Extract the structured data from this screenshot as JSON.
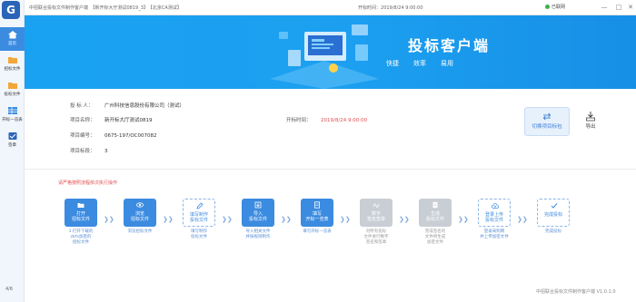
{
  "window": {
    "title": "中招联合投标文件制作客户端　【新开标大厅测试0819_3】　【北京CA测试】",
    "time_label": "开标时间：",
    "time_value": "2019/8/24 9:00:00",
    "network_status": "已联网",
    "network_color": "#3db14a"
  },
  "sidebar": {
    "logo": "G",
    "items": [
      {
        "label": "首页",
        "icon": "home-icon",
        "active": true
      },
      {
        "label": "招标文件",
        "icon": "folder-icon",
        "active": false
      },
      {
        "label": "投标文件",
        "icon": "folder-icon",
        "active": false
      },
      {
        "label": "开标一览表",
        "icon": "table-icon",
        "active": false
      },
      {
        "label": "签章",
        "icon": "stamp-icon",
        "active": false
      }
    ],
    "page_indicator": "4/6"
  },
  "banner": {
    "title": "投标客户端",
    "taglines": [
      "快捷",
      "效率",
      "易用"
    ]
  },
  "project": {
    "bidder_label": "投 标 人：",
    "bidder_value": "广州科技信息股份有限公司（测试）",
    "name_label": "项目名称：",
    "name_value": "新开标大厅测试0819",
    "open_time_label": "开标时间：",
    "open_time_value": "2019/8/24 9:00:00",
    "code_label": "项目编号：",
    "code_value": "0675-197/OC007082",
    "section_label": "项目标段：",
    "section_value": "3"
  },
  "actions": {
    "switch_label": "切换项目标包",
    "export_label": "导出"
  },
  "notice": "请严格按照流程依次执行操作",
  "steps": [
    {
      "label_lines": [
        "打开",
        "招标文件"
      ],
      "desc": [
        "1.打开下载的",
        "zbfx加密的",
        "招标文件"
      ],
      "status": "done"
    },
    {
      "label_lines": [
        "浏览",
        "招标文件"
      ],
      "desc": [
        "浏览招标文件"
      ],
      "status": "done"
    },
    {
      "label_lines": [
        "填写制作",
        "投标文件"
      ],
      "desc": [
        "填写制作",
        "投标文件"
      ],
      "status": "pending"
    },
    {
      "label_lines": [
        "导入",
        "投标文件"
      ],
      "desc": [
        "导入相关文件",
        "并按规则制作"
      ],
      "status": "done"
    },
    {
      "label_lines": [
        "填写",
        "开标一览表"
      ],
      "desc": [
        "填写开标一览表"
      ],
      "status": "done"
    },
    {
      "label_lines": [
        "数字",
        "签名签章"
      ],
      "desc": [
        "对所有投标",
        "文件进行数字",
        "签名和签章"
      ],
      "status": "disabled"
    },
    {
      "label_lines": [
        "生成",
        "投标文件"
      ],
      "desc": [
        "完成签名的",
        "文件将生成",
        "加密文件"
      ],
      "status": "disabled"
    },
    {
      "label_lines": [
        "登录上传",
        "投标文件"
      ],
      "desc": [
        "登录采购网",
        "并上传加密文件"
      ],
      "status": "pending"
    },
    {
      "label_lines": [
        "完成投标"
      ],
      "desc": [
        "完成投标"
      ],
      "status": "pending"
    }
  ],
  "footer": "中招联合投标文件制作客户端 V1.0.1.0",
  "colors": {
    "brand": "#2a64b8",
    "banner": "#1aa2f2",
    "step_done": "#3b8be0",
    "step_disabled": "#c9ced4",
    "warning": "#e05050"
  }
}
